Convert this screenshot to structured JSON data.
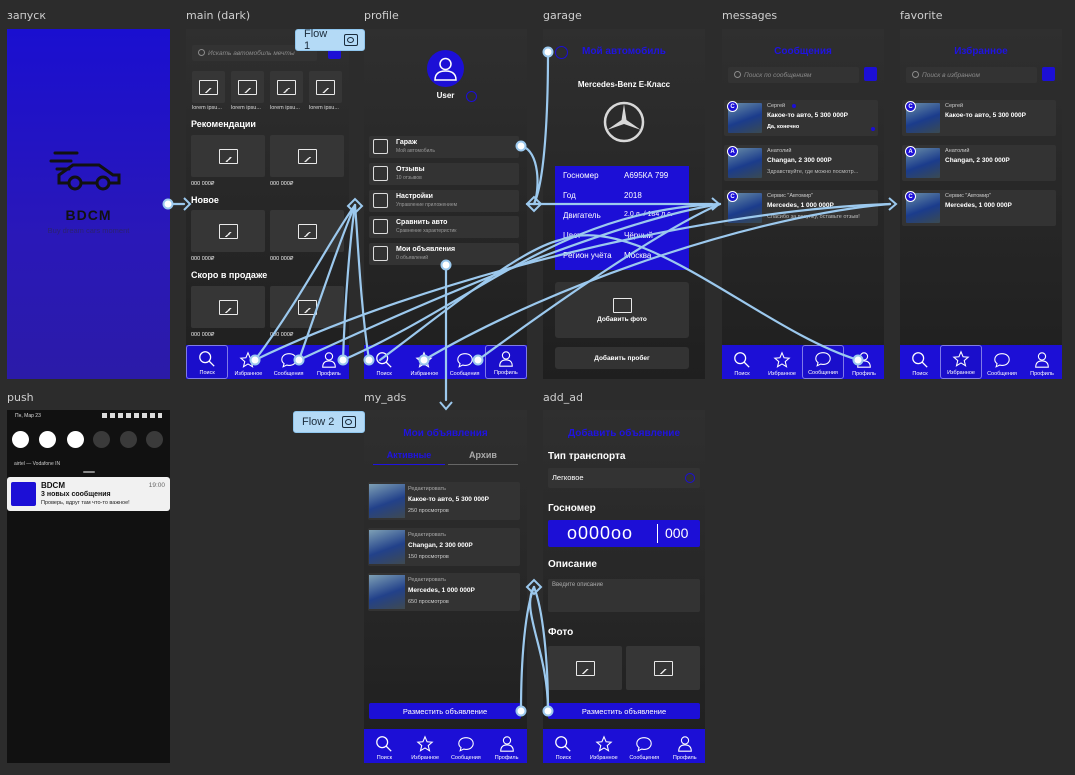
{
  "frames": {
    "launch": "запуск",
    "main": "main (dark)",
    "profile": "profile",
    "garage": "garage",
    "messages": "messages",
    "favorite": "favorite",
    "push": "push",
    "my_ads": "my_ads",
    "add_ad": "add_ad"
  },
  "flows": {
    "flow1": "Flow 1",
    "flow2": "Flow 2"
  },
  "colors": {
    "brand": "#1c0fd6",
    "flow_line": "#9cc9ee",
    "canvas": "#2c2c2c"
  },
  "tabs": {
    "search": "Поиск",
    "favorites": "Избранное",
    "messages": "Сообщения",
    "profile": "Профиль"
  },
  "launch": {
    "logo_text": "BDCM",
    "slogan": "Buy dream cars moment",
    "icon": "car-icon"
  },
  "main": {
    "search_placeholder": "Искать автомобиль мечты",
    "thumb_caption": "lorem ipsu...",
    "sections": [
      "Рекомендации",
      "Новое",
      "Скоро в продаже"
    ],
    "price": "000 000₽"
  },
  "profile": {
    "user_label": "User",
    "menu": [
      {
        "title": "Гараж",
        "subtitle": "Мой автомобиль"
      },
      {
        "title": "Отзывы",
        "subtitle": "10 отзывов"
      },
      {
        "title": "Настройки",
        "subtitle": "Управление приложением"
      },
      {
        "title": "Сравнить авто",
        "subtitle": "Сравнение характеристик"
      },
      {
        "title": "Мои объявления",
        "subtitle": "0 объявлений"
      }
    ]
  },
  "garage": {
    "title": "Мой автомобиль",
    "car_name": "Mercedes-Benz E-Класс",
    "specs": [
      {
        "k": "Госномер",
        "v": "А695КА 799"
      },
      {
        "k": "Год",
        "v": "2018"
      },
      {
        "k": "Двигатель",
        "v": "2.0 л. / 184 л.с."
      },
      {
        "k": "Цвет",
        "v": "Чёрный"
      },
      {
        "k": "Регион учёта",
        "v": "Москва"
      }
    ],
    "add_photo": "Добавить фото",
    "add_mileage": "Добавить пробег"
  },
  "messages": {
    "title": "Сообщения",
    "search_placeholder": "Поиск по сообщениям",
    "items": [
      {
        "badge": "С",
        "name": "Сергей",
        "headline": "Какое-то авто, 5 300 000Р",
        "preview": "Да, конечно"
      },
      {
        "badge": "А",
        "name": "Анатолий",
        "headline": "Changan, 2 300 000Р",
        "preview": "Здравствуйте, где можно посмотр..."
      },
      {
        "badge": "С",
        "name": "Сервис \"Автомир\"",
        "headline": "Mercedes, 1 000 000Р",
        "preview": "Спасибо за покупку, оставьте отзыв!"
      }
    ]
  },
  "favorite": {
    "title": "Избранное",
    "search_placeholder": "Поиск в избранном",
    "items": [
      {
        "badge": "С",
        "name": "Сергей",
        "headline": "Какое-то авто, 5 300 000Р"
      },
      {
        "badge": "А",
        "name": "Анатолий",
        "headline": "Changan, 2 300 000Р"
      },
      {
        "badge": "С",
        "name": "Сервис \"Автомир\"",
        "headline": "Mercedes, 1 000 000Р"
      }
    ]
  },
  "push": {
    "date": "Пн, Мар 23",
    "operator": "airtel — Vodafone IN",
    "app": "BDCM",
    "time": "19:00",
    "title": "3 новых сообщения",
    "body": "Проверь, вдруг там что-то важное!"
  },
  "my_ads": {
    "title": "Мои объявления",
    "tab_active": "Активные",
    "tab_archive": "Архив",
    "edit_label": "Редактировать",
    "items": [
      {
        "title": "Какое-то авто, 5 300 000Р",
        "views": "250 просмотров"
      },
      {
        "title": "Changan, 2 300 000Р",
        "views": "150 просмотров"
      },
      {
        "title": "Mercedes, 1 000 000Р",
        "views": "650 просмотров"
      }
    ],
    "post_button": "Разместить объявление"
  },
  "add_ad": {
    "title": "Добавить объявление",
    "type_label": "Тип транспорта",
    "type_value": "Легковое",
    "plate_label": "Госномер",
    "plate_value": "о000оо",
    "plate_region": "000",
    "desc_label": "Описание",
    "desc_placeholder": "Введите описание",
    "photo_label": "Фото",
    "post_button": "Разместить объявление"
  }
}
